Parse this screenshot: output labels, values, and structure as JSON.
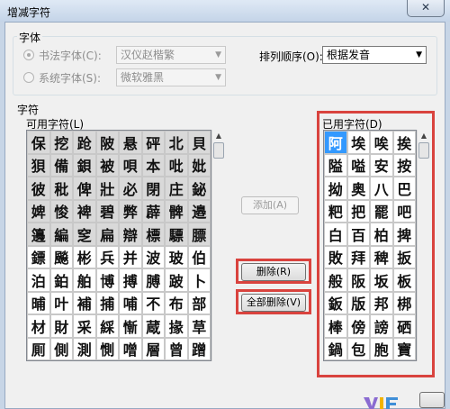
{
  "window": {
    "title": "增减字符",
    "close_glyph": "✕"
  },
  "font_group": {
    "label": "字体",
    "calligraphy": {
      "label": "书法字体(C):",
      "value": "汉仪赵楷繁",
      "selected": true
    },
    "system": {
      "label": "系统字体(S):",
      "value": "微软雅黑",
      "selected": false
    },
    "sort": {
      "label": "排列顺序(O):",
      "value": "根据发音"
    }
  },
  "chars_group": {
    "label": "字符",
    "available": {
      "label": "可用字符(L)",
      "rows": [
        [
          "保",
          "挖",
          "跄",
          "陂",
          "悬",
          "砰",
          "北",
          "貝"
        ],
        [
          "狽",
          "備",
          "鋇",
          "被",
          "唄",
          "本",
          "吡",
          "妣"
        ],
        [
          "彼",
          "秕",
          "俾",
          "壯",
          "必",
          "閉",
          "庄",
          "鉍"
        ],
        [
          "婢",
          "悛",
          "裨",
          "碧",
          "弊",
          "薜",
          "髀",
          "邉"
        ],
        [
          "籩",
          "編",
          "窆",
          "扁",
          "辯",
          "標",
          "驃",
          "膘"
        ],
        [
          "鏢",
          "飈",
          "彬",
          "兵",
          "并",
          "波",
          "玻",
          "伯"
        ],
        [
          "泊",
          "鉑",
          "舶",
          "博",
          "搏",
          "膊",
          "跛",
          "卜"
        ],
        [
          "晡",
          "叶",
          "補",
          "捕",
          "哺",
          "不",
          "布",
          "部"
        ],
        [
          "材",
          "財",
          "采",
          "綵",
          "慚",
          "蔵",
          "掾",
          "草"
        ],
        [
          "厠",
          "側",
          "測",
          "惻",
          "噌",
          "層",
          "曾",
          "蹭"
        ]
      ],
      "gray_rows": 5
    },
    "used": {
      "label": "已用字符(D)",
      "rows": [
        [
          "阿",
          "埃",
          "唉",
          "挨"
        ],
        [
          "隘",
          "嗌",
          "安",
          "按"
        ],
        [
          "拗",
          "奥",
          "八",
          "巴"
        ],
        [
          "粑",
          "把",
          "罷",
          "吧"
        ],
        [
          "白",
          "百",
          "柏",
          "捭"
        ],
        [
          "敗",
          "拜",
          "稗",
          "扳"
        ],
        [
          "般",
          "阪",
          "坂",
          "板"
        ],
        [
          "鈑",
          "版",
          "邦",
          "梆"
        ],
        [
          "棒",
          "傍",
          "謗",
          "硒"
        ],
        [
          "鍋",
          "包",
          "胞",
          "寶"
        ]
      ]
    }
  },
  "buttons": {
    "add": "添加(A)",
    "delete": "删除(R)",
    "delete_all": "全部删除(V)"
  },
  "scroll_glyphs": {
    "up": "▲",
    "combo_arrow": "▼"
  },
  "colors": {
    "highlight": "#d9433e",
    "selection": "#3399ff"
  }
}
